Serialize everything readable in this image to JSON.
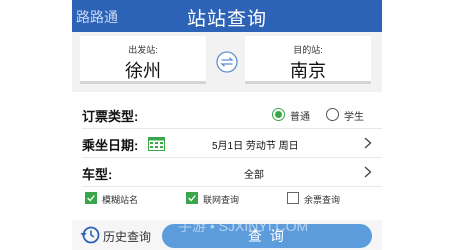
{
  "header": {
    "app_name": "路路通",
    "title": "站站查询"
  },
  "stations": {
    "from_label": "出发站:",
    "from_value": "徐州",
    "to_label": "目的站:",
    "to_value": "南京"
  },
  "ticket_type": {
    "label": "订票类型:",
    "options": [
      {
        "label": "普通",
        "selected": true
      },
      {
        "label": "学生",
        "selected": false
      }
    ]
  },
  "date": {
    "label": "乘坐日期:",
    "value": "5月1日 劳动节 周日"
  },
  "train_type": {
    "label": "车型:",
    "value": "全部"
  },
  "options": [
    {
      "label": "模糊站名",
      "checked": true
    },
    {
      "label": "联网查询",
      "checked": true
    },
    {
      "label": "余票查询",
      "checked": false
    }
  ],
  "bottom": {
    "history_label": "历史查询",
    "query_label": "查 询"
  },
  "watermark": "手游 • SJXINYI.COM",
  "colors": {
    "header": "#2d63b6",
    "accent_green": "#39a64a",
    "button_blue": "#5c9cdc"
  }
}
